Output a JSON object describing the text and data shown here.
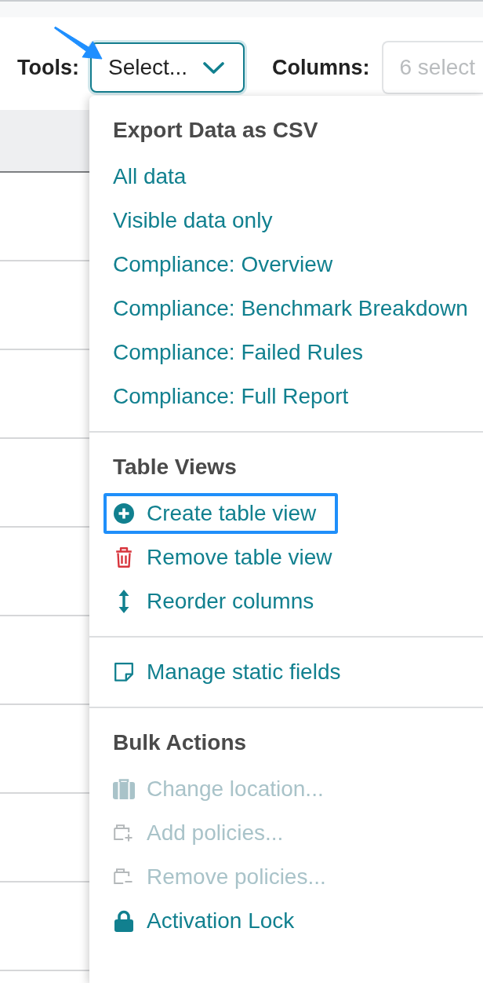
{
  "toolbar": {
    "tools_label": "Tools:",
    "tools_select": {
      "value": "Select...",
      "expanded": true
    },
    "columns_label": "Columns:",
    "columns_select": {
      "placeholder": "6 select"
    }
  },
  "tools_menu": {
    "sections": [
      {
        "heading": "Export Data as CSV",
        "items": [
          {
            "label": "All data",
            "disabled": false,
            "highlighted": false
          },
          {
            "label": "Visible data only",
            "disabled": false,
            "highlighted": false
          },
          {
            "label": "Compliance: Overview",
            "disabled": false,
            "highlighted": false
          },
          {
            "label": "Compliance: Benchmark Breakdown",
            "disabled": false,
            "highlighted": false
          },
          {
            "label": "Compliance: Failed Rules",
            "disabled": false,
            "highlighted": false
          },
          {
            "label": "Compliance: Full Report",
            "disabled": false,
            "highlighted": false
          }
        ]
      },
      {
        "heading": "Table Views",
        "items": [
          {
            "label": "Create table view",
            "disabled": false,
            "highlighted": true
          },
          {
            "label": "Remove table view",
            "disabled": false,
            "highlighted": false
          },
          {
            "label": "Reorder columns",
            "disabled": false,
            "highlighted": false
          }
        ]
      },
      {
        "items": [
          {
            "label": "Manage static fields",
            "disabled": false,
            "highlighted": false
          }
        ]
      },
      {
        "heading": "Bulk Actions",
        "items": [
          {
            "label": "Change location...",
            "disabled": true,
            "highlighted": false
          },
          {
            "label": "Add policies...",
            "disabled": true,
            "highlighted": false
          },
          {
            "label": "Remove policies...",
            "disabled": true,
            "highlighted": false
          },
          {
            "label": "Activation Lock",
            "disabled": false,
            "highlighted": false
          }
        ]
      }
    ]
  }
}
